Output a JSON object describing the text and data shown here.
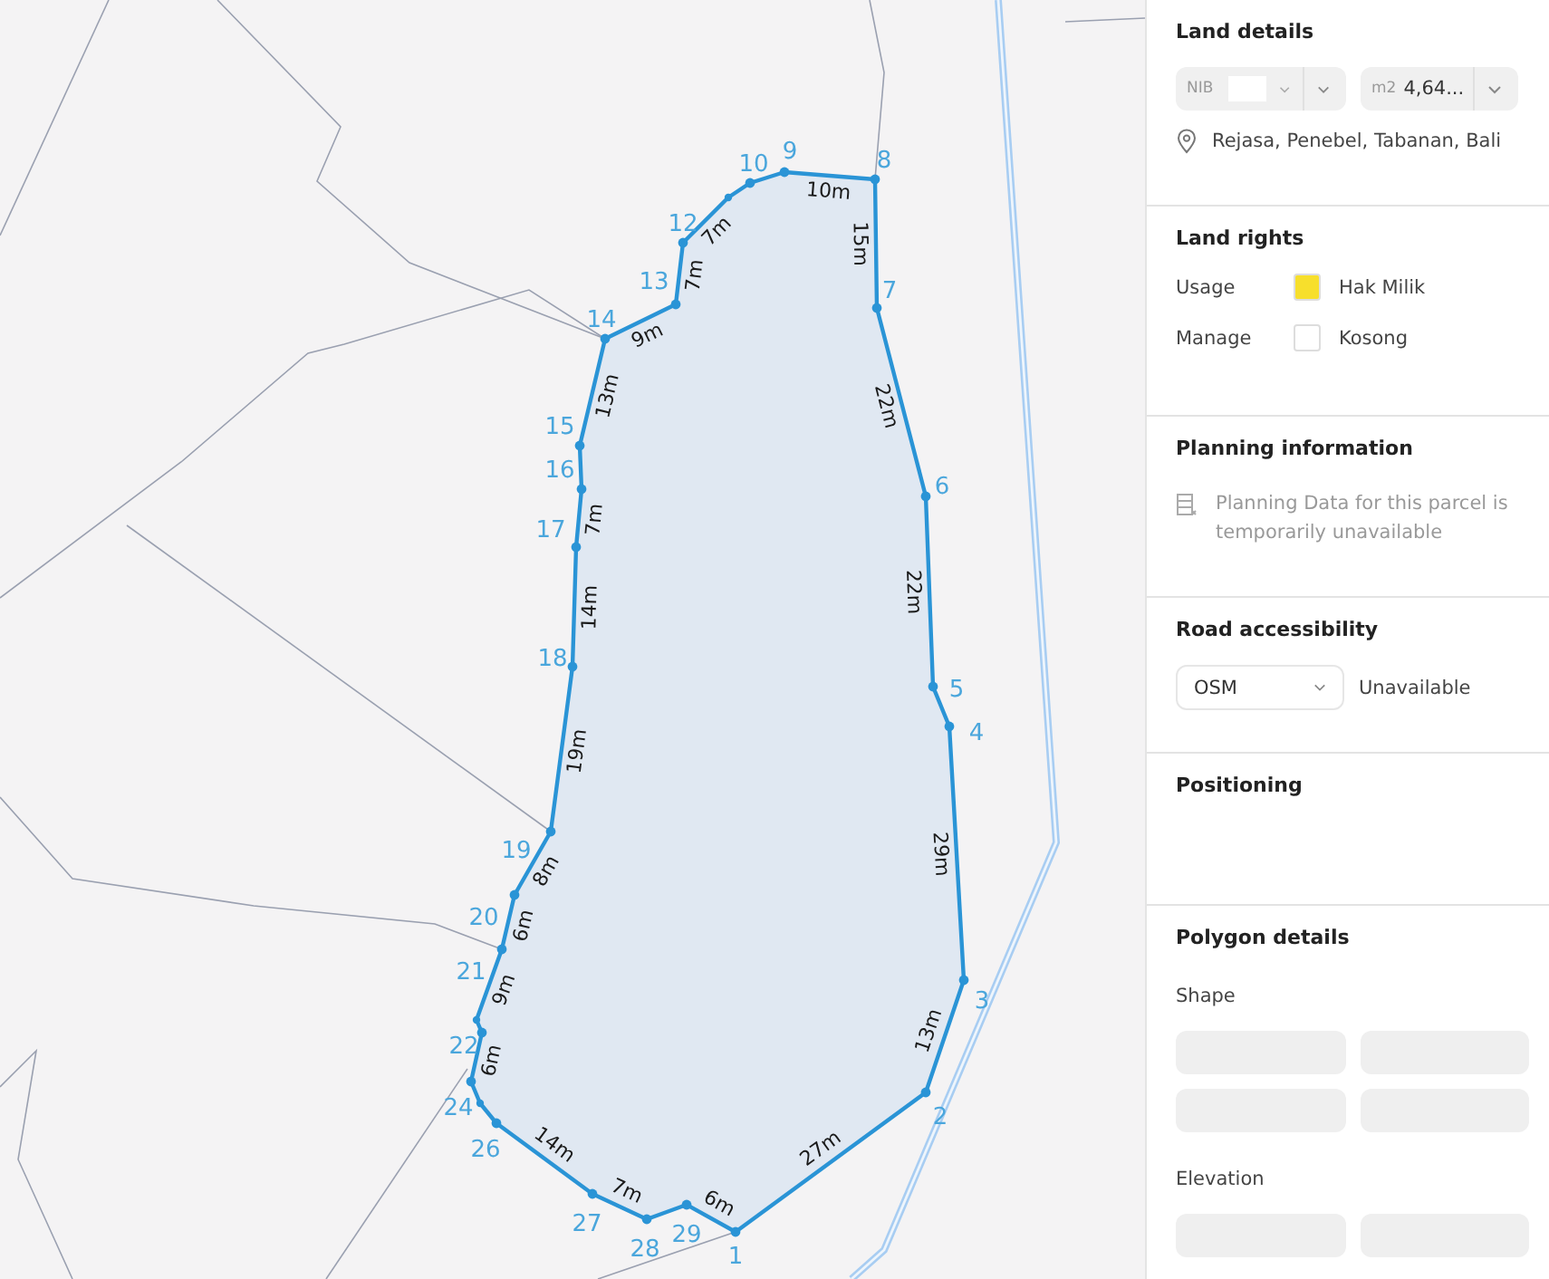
{
  "map": {
    "parcel": {
      "vertices": [
        {
          "label": "1",
          "edge": "27m"
        },
        {
          "label": "2",
          "edge": "13m"
        },
        {
          "label": "3",
          "edge": "29m"
        },
        {
          "label": "4"
        },
        {
          "label": "5",
          "edge": "22m"
        },
        {
          "label": "6",
          "edge": "22m"
        },
        {
          "label": "7",
          "edge": "15m"
        },
        {
          "label": "8",
          "edge": "10m"
        },
        {
          "label": "9"
        },
        {
          "label": "10"
        },
        {
          "kind": "plain",
          "edge": "7m"
        },
        {
          "label": "12",
          "edge": "7m"
        },
        {
          "label": "13",
          "edge": "9m"
        },
        {
          "label": "14",
          "edge": "13m"
        },
        {
          "label": "15"
        },
        {
          "label": "16",
          "edge": "7m"
        },
        {
          "label": "17",
          "edge": "14m"
        },
        {
          "label": "18",
          "edge": "19m"
        },
        {
          "label": "19",
          "edge": "8m"
        },
        {
          "label": "20",
          "edge": "6m"
        },
        {
          "label": "21",
          "edge": "9m"
        },
        {
          "kind": "plain"
        },
        {
          "label": "22",
          "edge": "6m"
        },
        {
          "label": "24"
        },
        {
          "kind": "plain"
        },
        {
          "label": "26",
          "edge": "14m"
        },
        {
          "label": "27",
          "edge": "7m"
        },
        {
          "label": "28"
        },
        {
          "label": "29",
          "edge": "6m"
        }
      ]
    }
  },
  "panel": {
    "land_details": {
      "title": "Land details",
      "nib": {
        "label": "NIB"
      },
      "area": {
        "unit": "m2",
        "value": "4,64..."
      },
      "location": "Rejasa, Penebel, Tabanan, Bali"
    },
    "land_rights": {
      "title": "Land rights",
      "rows": [
        {
          "label": "Usage",
          "value": "Hak Milik",
          "color": "#f7df2c"
        },
        {
          "label": "Manage",
          "value": "Kosong",
          "color": "#ffffff"
        }
      ]
    },
    "planning": {
      "title": "Planning information",
      "message": "Planning Data for this parcel is temporarily unavailable"
    },
    "road": {
      "title": "Road accessibility",
      "source": "OSM",
      "status": "Unavailable"
    },
    "positioning": {
      "title": "Positioning"
    },
    "polygon": {
      "title": "Polygon details",
      "groups": [
        {
          "label": "Shape",
          "items": [
            {
              "kind": "loading"
            },
            {
              "kind": "loading"
            },
            {
              "kind": "loading"
            },
            {
              "kind": "loading"
            }
          ]
        },
        {
          "label": "Elevation",
          "items": [
            {
              "kind": "loading"
            },
            {
              "kind": "loading"
            }
          ]
        }
      ]
    }
  }
}
